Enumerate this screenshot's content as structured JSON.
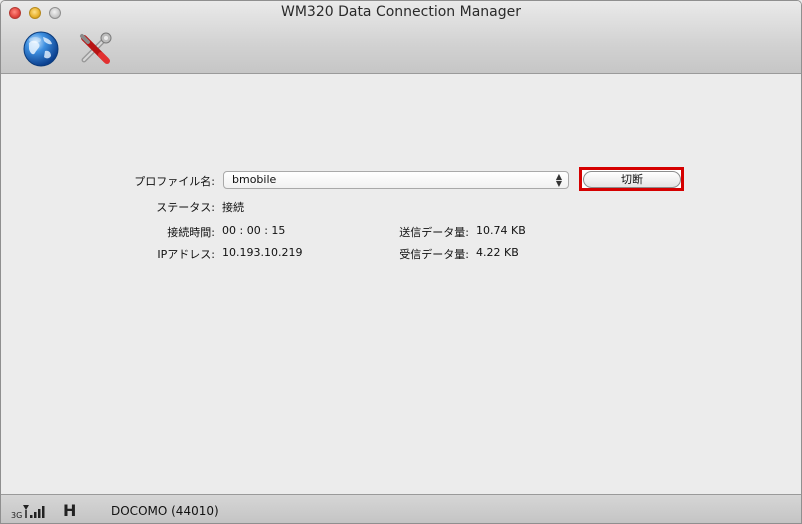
{
  "window": {
    "title": "WM320 Data Connection Manager"
  },
  "toolbar": {
    "items": [
      {
        "icon": "globe-icon"
      },
      {
        "icon": "tools-icon"
      }
    ]
  },
  "connection": {
    "profile_label": "プロファイル名:",
    "profile_value": "bmobile",
    "disconnect_label": "切断",
    "status_label": "ステータス:",
    "status_value": "接続",
    "time_label": "接続時間:",
    "time_value": "00 : 00 : 15",
    "ip_label": "IPアドレス:",
    "ip_value": "10.193.10.219",
    "sent_label": "送信データ量:",
    "sent_value": "10.74 KB",
    "recv_label": "受信データ量:",
    "recv_value": "4.22 KB"
  },
  "statusbar": {
    "signal_text": "3G",
    "network_type": "H",
    "carrier": "DOCOMO (44010)"
  },
  "colors": {
    "highlight": "#d50000"
  }
}
